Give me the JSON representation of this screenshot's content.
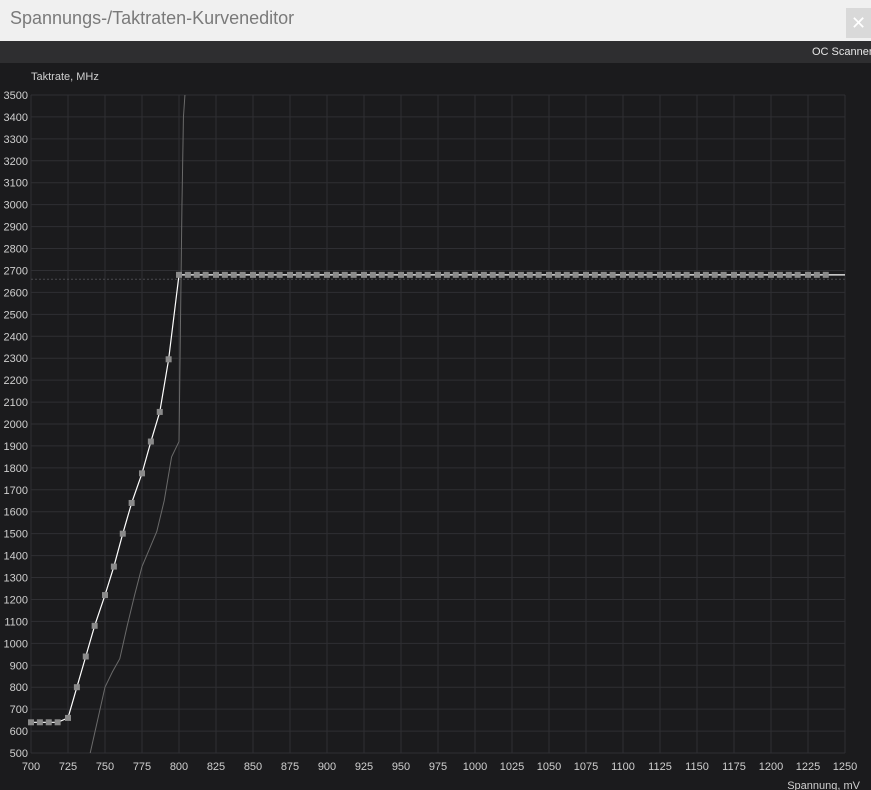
{
  "window": {
    "title": "Spannungs-/Taktraten-Kurveneditor",
    "close_glyph": "✕"
  },
  "toolbar": {
    "oc_scanner_label": "OC Scanner"
  },
  "colors": {
    "background": "#1b1b1d",
    "grid": "#2f2f33",
    "curve": "#ffffff",
    "points": "#8a8a8a",
    "reference_curve": "#6a6a6a",
    "axis_text": "#cfcfcf"
  },
  "chart_data": {
    "type": "line",
    "ylabel": "Taktrate, MHz",
    "xlabel": "Spannung, mV",
    "xlim": [
      700,
      1250
    ],
    "ylim": [
      500,
      3500
    ],
    "grid": true,
    "x_ticks": [
      700,
      725,
      750,
      775,
      800,
      825,
      850,
      875,
      900,
      925,
      950,
      975,
      1000,
      1025,
      1050,
      1075,
      1100,
      1125,
      1150,
      1175,
      1200,
      1225,
      1250
    ],
    "y_ticks": [
      500,
      600,
      700,
      800,
      900,
      1000,
      1100,
      1200,
      1300,
      1400,
      1500,
      1600,
      1700,
      1800,
      1900,
      2000,
      2100,
      2200,
      2300,
      2400,
      2500,
      2600,
      2700,
      2800,
      2900,
      3000,
      3100,
      3200,
      3300,
      3400,
      3500
    ],
    "series": [
      {
        "role": "edited-curve",
        "x": [
          700,
          706,
          712,
          718,
          725,
          731,
          737,
          743,
          750,
          756,
          762,
          768,
          775,
          781,
          787,
          793,
          800,
          806,
          812,
          818,
          825,
          831,
          837,
          843,
          850,
          856,
          862,
          868,
          875,
          881,
          887,
          893,
          900,
          906,
          912,
          918,
          925,
          931,
          937,
          943,
          950,
          956,
          962,
          968,
          975,
          981,
          987,
          993,
          1000,
          1006,
          1012,
          1018,
          1025,
          1031,
          1037,
          1043,
          1050,
          1056,
          1062,
          1068,
          1075,
          1081,
          1087,
          1093,
          1100,
          1106,
          1112,
          1118,
          1125,
          1131,
          1137,
          1143,
          1150,
          1156,
          1162,
          1168,
          1175,
          1181,
          1187,
          1193,
          1200,
          1206,
          1212,
          1218,
          1225,
          1231,
          1237
        ],
        "y": [
          640,
          640,
          640,
          640,
          660,
          800,
          940,
          1080,
          1220,
          1350,
          1500,
          1640,
          1775,
          1920,
          2055,
          2295,
          2680,
          2680,
          2680,
          2680,
          2680,
          2680,
          2680,
          2680,
          2680,
          2680,
          2680,
          2680,
          2680,
          2680,
          2680,
          2680,
          2680,
          2680,
          2680,
          2680,
          2680,
          2680,
          2680,
          2680,
          2680,
          2680,
          2680,
          2680,
          2680,
          2680,
          2680,
          2680,
          2680,
          2680,
          2680,
          2680,
          2680,
          2680,
          2680,
          2680,
          2680,
          2680,
          2680,
          2680,
          2680,
          2680,
          2680,
          2680,
          2680,
          2680,
          2680,
          2680,
          2680,
          2680,
          2680,
          2680,
          2680,
          2680,
          2680,
          2680,
          2680,
          2680,
          2680,
          2680,
          2680,
          2680,
          2680,
          2680,
          2680,
          2680,
          2680
        ]
      },
      {
        "role": "reference-curve",
        "x": [
          740,
          745,
          750,
          755,
          760,
          765,
          770,
          775,
          780,
          785,
          790,
          795,
          800,
          802,
          803,
          804
        ],
        "y": [
          500,
          650,
          800,
          870,
          930,
          1080,
          1220,
          1350,
          1430,
          1510,
          1650,
          1850,
          1920,
          3000,
          3400,
          3500
        ]
      }
    ],
    "reference_line_y": 2660,
    "final_x": 1250
  }
}
